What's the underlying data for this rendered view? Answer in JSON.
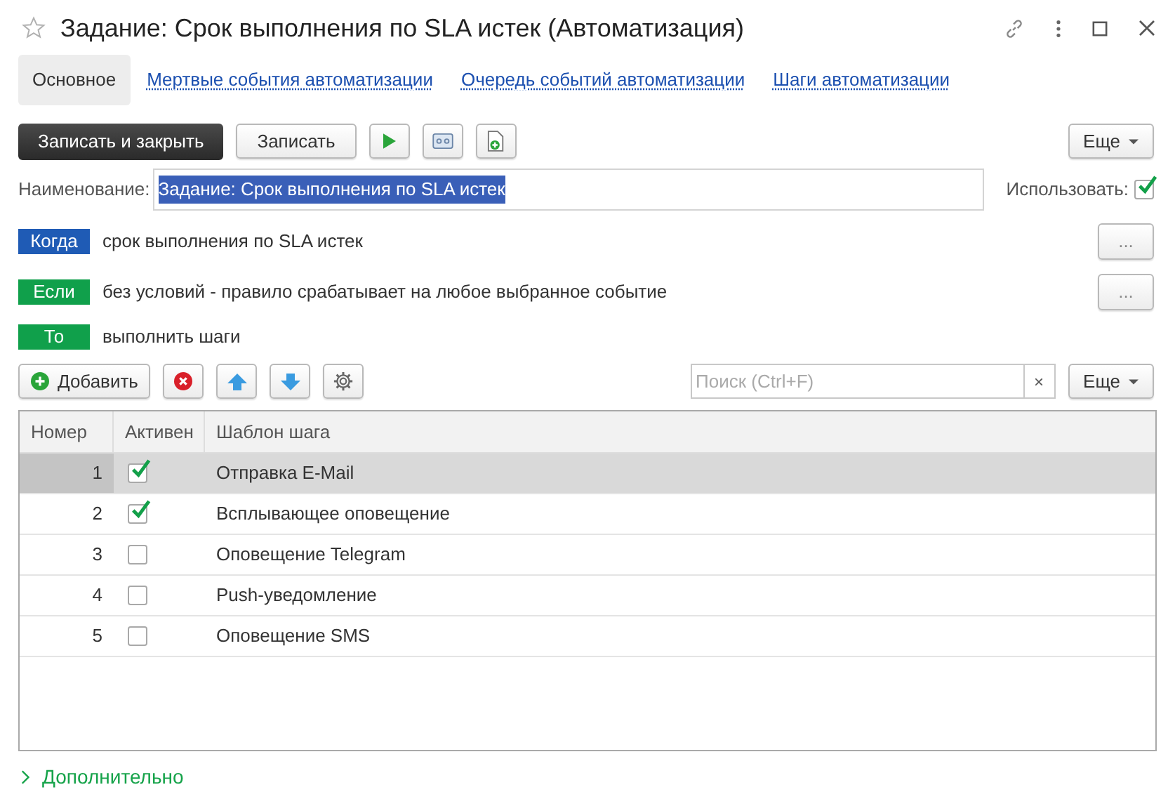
{
  "window": {
    "title": "Задание: Срок выполнения по SLA истек (Автоматизация)"
  },
  "tabs": [
    {
      "label": "Основное",
      "selected": true
    },
    {
      "label": "Мертвые события автоматизации",
      "selected": false
    },
    {
      "label": "Очередь событий автоматизации",
      "selected": false
    },
    {
      "label": "Шаги автоматизации",
      "selected": false
    }
  ],
  "toolbar": {
    "primary": "Записать и закрыть",
    "save": "Записать",
    "more": "Еще"
  },
  "name_field": {
    "label": "Наименование:",
    "value": "Задание: Срок выполнения по SLA истек"
  },
  "use": {
    "label": "Использовать:",
    "checked": true
  },
  "rules": [
    {
      "tag": "Когда",
      "color": "#1f5bb5",
      "text": "срок выполнения по SLA истек",
      "button": "..."
    },
    {
      "tag": "Если",
      "color": "#10a04b",
      "text": "без условий - правило срабатывает на любое выбранное событие",
      "button": "..."
    },
    {
      "tag": "То",
      "color": "#10a04b",
      "text": "выполнить шаги"
    }
  ],
  "table_toolbar": {
    "add": "Добавить",
    "search": {
      "placeholder": "Поиск (Ctrl+F)"
    },
    "clear": "×",
    "more": "Еще"
  },
  "table": {
    "columns": [
      "Номер",
      "Активен",
      "Шаблон шага"
    ],
    "rows": [
      {
        "number": "1",
        "active": true,
        "template": "Отправка E-Mail",
        "selected": true
      },
      {
        "number": "2",
        "active": true,
        "template": "Всплывающее оповещение",
        "selected": false
      },
      {
        "number": "3",
        "active": false,
        "template": "Оповещение Telegram",
        "selected": false
      },
      {
        "number": "4",
        "active": false,
        "template": "Push-уведомление",
        "selected": false
      },
      {
        "number": "5",
        "active": false,
        "template": "Оповещение SMS",
        "selected": false
      }
    ]
  },
  "footer": {
    "label": "Дополнительно",
    "expanded": false
  }
}
